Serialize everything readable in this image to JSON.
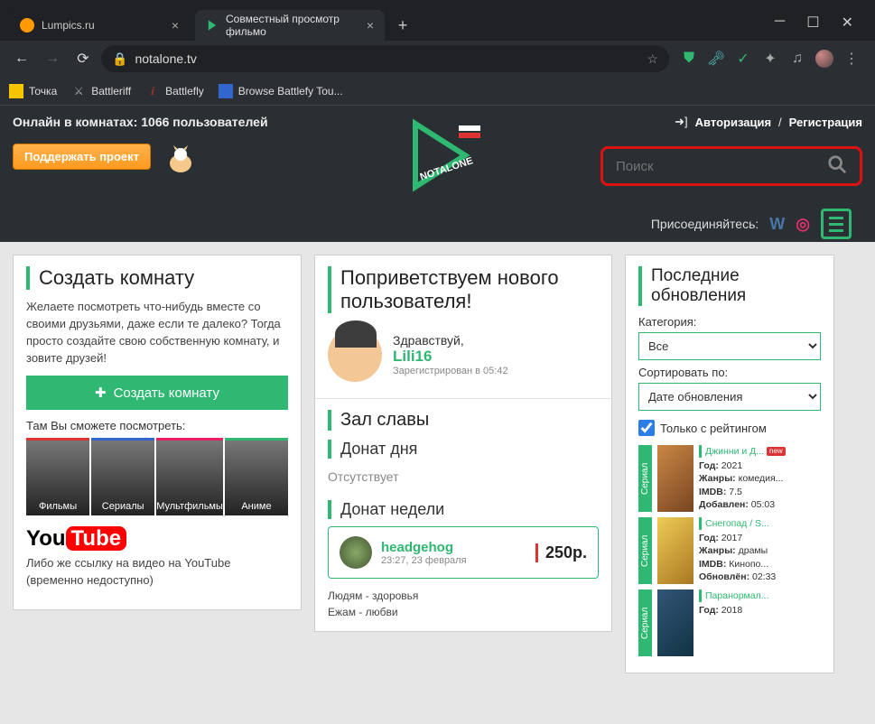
{
  "browser": {
    "tabs": [
      {
        "title": "Lumpics.ru",
        "favicon_color": "#f90"
      },
      {
        "title": "Совместный просмотр фильмо",
        "favicon_color": "#2eb872"
      }
    ],
    "url": "notalone.tv",
    "bookmarks": [
      {
        "label": "Точка",
        "icon_color": "#f6c500"
      },
      {
        "label": "Battleriff",
        "icon_color": "#777"
      },
      {
        "label": "Battlefly",
        "icon_color": "#d33"
      },
      {
        "label": "Browse Battlefy Tou...",
        "icon_color": "#36c"
      }
    ]
  },
  "site": {
    "online_label": "Онлайн в комнатах: 1066 пользователей",
    "auth_login": "Авторизация",
    "auth_sep": "/",
    "auth_register": "Регистрация",
    "support_label": "Поддержать проект",
    "search_placeholder": "Поиск",
    "join_label": "Присоединяйтесь:"
  },
  "create_room": {
    "title": "Создать комнату",
    "desc": "Желаете посмотреть что-нибудь вместе со своими друзьями, даже если те далеко? Тогда просто создайте свою собственную комнату, и зовите друзей!",
    "button": "Создать комнату",
    "watch_label": "Там Вы сможете посмотреть:",
    "thumbs": [
      "Фильмы",
      "Сериалы",
      "Мультфильмы",
      "Аниме"
    ],
    "yt_note": "Либо же ссылку на видео на YouTube (временно недоступно)"
  },
  "greet": {
    "title": "Поприветствуем нового пользователя!",
    "hello": "Здравствуй,",
    "name": "Lili16",
    "sub": "Зарегистрирован в 05:42"
  },
  "fame": {
    "title": "Зал славы",
    "donate_day": "Донат дня",
    "absent": "Отсутствует",
    "donate_week": "Донат недели",
    "donor_name": "headgehog",
    "donor_time": "23:27, 23 февраля",
    "donor_sum": "250р.",
    "poem1": "Людям - здоровья",
    "poem2": "Ежам - любви"
  },
  "updates": {
    "title": "Последние обновления",
    "cat_label": "Категория:",
    "cat_value": "Все",
    "sort_label": "Сортировать по:",
    "sort_value": "Дате обновления",
    "rating_only": "Только с рейтингом",
    "items": [
      {
        "tag": "Сериал",
        "title": "Джинни и Д...",
        "new": true,
        "year": "2021",
        "genres": "комедия...",
        "imdb": "7.5",
        "added": "05:03"
      },
      {
        "tag": "Сериал",
        "title": "Снегопад / S...",
        "new": false,
        "year": "2017",
        "genres": "драмы",
        "imdb": "Кинопо...",
        "updated": "02:33"
      },
      {
        "tag": "Сериал",
        "title": "Паранормал...",
        "new": false,
        "year": "2018"
      }
    ]
  },
  "labels": {
    "year": "Год:",
    "genres": "Жанры:",
    "imdb": "IMDB:",
    "added": "Добавлен:",
    "updated": "Обновлён:"
  }
}
